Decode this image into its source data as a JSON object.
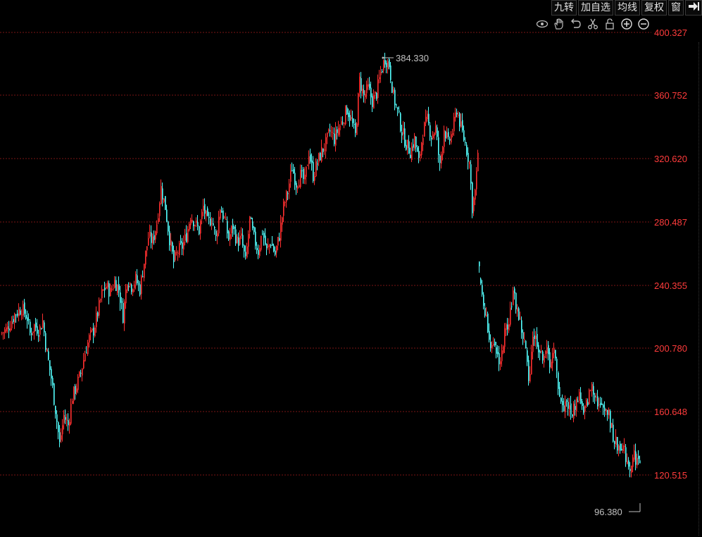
{
  "toolbar": {
    "buttons": [
      "九转",
      "加自选",
      "均线",
      "复权",
      "窗"
    ],
    "exit_icon": "exit-arrow-icon"
  },
  "tools": [
    {
      "name": "eye-icon"
    },
    {
      "name": "hand-icon"
    },
    {
      "name": "undo-icon"
    },
    {
      "name": "scissors-icon"
    },
    {
      "name": "lock-icon"
    },
    {
      "name": "zoom-in-icon"
    },
    {
      "name": "zoom-out-icon"
    }
  ],
  "colors": {
    "background": "#000000",
    "up": "#ff3030",
    "down": "#54ffff",
    "grid": "#7a1515",
    "axis_label": "#ff3b3b",
    "annotation": "#c0c0c0"
  },
  "chart_data": {
    "type": "candlestick",
    "y_ticks": [
      "400.327",
      "360.752",
      "320.620",
      "280.487",
      "240.355",
      "200.780",
      "160.648",
      "120.515"
    ],
    "y_tick_values": [
      400.327,
      360.752,
      320.62,
      280.487,
      240.355,
      200.78,
      160.648,
      120.515
    ],
    "grid": true,
    "annotations": {
      "high": {
        "label": "384.330",
        "value": 384.33
      },
      "low": {
        "label": "96.380",
        "value": 96.38
      }
    },
    "close_path": [
      [
        0,
        210
      ],
      [
        10,
        213
      ],
      [
        20,
        222
      ],
      [
        30,
        226
      ],
      [
        38,
        220
      ],
      [
        42,
        210
      ],
      [
        48,
        215
      ],
      [
        55,
        212
      ],
      [
        60,
        218
      ],
      [
        65,
        200
      ],
      [
        72,
        182
      ],
      [
        78,
        162
      ],
      [
        84,
        140
      ],
      [
        90,
        158
      ],
      [
        96,
        152
      ],
      [
        102,
        170
      ],
      [
        108,
        177
      ],
      [
        114,
        185
      ],
      [
        120,
        198
      ],
      [
        126,
        207
      ],
      [
        132,
        212
      ],
      [
        138,
        223
      ],
      [
        144,
        235
      ],
      [
        150,
        240
      ],
      [
        156,
        236
      ],
      [
        162,
        243
      ],
      [
        168,
        238
      ],
      [
        174,
        221
      ],
      [
        180,
        245
      ],
      [
        186,
        240
      ],
      [
        192,
        244
      ],
      [
        198,
        238
      ],
      [
        204,
        255
      ],
      [
        210,
        271
      ],
      [
        216,
        268
      ],
      [
        222,
        280
      ],
      [
        228,
        302
      ],
      [
        234,
        290
      ],
      [
        240,
        270
      ],
      [
        246,
        255
      ],
      [
        252,
        262
      ],
      [
        258,
        265
      ],
      [
        264,
        272
      ],
      [
        270,
        285
      ],
      [
        276,
        280
      ],
      [
        282,
        275
      ],
      [
        288,
        290
      ],
      [
        294,
        280
      ],
      [
        300,
        283
      ],
      [
        306,
        270
      ],
      [
        312,
        290
      ],
      [
        318,
        282
      ],
      [
        324,
        270
      ],
      [
        330,
        278
      ],
      [
        336,
        268
      ],
      [
        342,
        270
      ],
      [
        348,
        255
      ],
      [
        354,
        282
      ],
      [
        360,
        270
      ],
      [
        366,
        262
      ],
      [
        372,
        275
      ],
      [
        378,
        262
      ],
      [
        384,
        268
      ],
      [
        390,
        260
      ],
      [
        396,
        272
      ],
      [
        402,
        290
      ],
      [
        408,
        300
      ],
      [
        414,
        315
      ],
      [
        420,
        305
      ],
      [
        426,
        310
      ],
      [
        432,
        306
      ],
      [
        438,
        325
      ],
      [
        444,
        310
      ],
      [
        450,
        318
      ],
      [
        456,
        325
      ],
      [
        462,
        330
      ],
      [
        468,
        338
      ],
      [
        474,
        333
      ],
      [
        480,
        340
      ],
      [
        486,
        345
      ],
      [
        492,
        352
      ],
      [
        498,
        345
      ],
      [
        504,
        335
      ],
      [
        510,
        370
      ],
      [
        516,
        360
      ],
      [
        522,
        365
      ],
      [
        528,
        357
      ],
      [
        534,
        362
      ],
      [
        540,
        375
      ],
      [
        546,
        384
      ],
      [
        552,
        380
      ],
      [
        558,
        360
      ],
      [
        564,
        350
      ],
      [
        570,
        338
      ],
      [
        576,
        330
      ],
      [
        582,
        325
      ],
      [
        588,
        333
      ],
      [
        594,
        318
      ],
      [
        600,
        338
      ],
      [
        606,
        345
      ],
      [
        612,
        335
      ],
      [
        618,
        340
      ],
      [
        624,
        315
      ],
      [
        630,
        340
      ],
      [
        636,
        330
      ],
      [
        642,
        338
      ],
      [
        648,
        352
      ],
      [
        654,
        340
      ],
      [
        660,
        330
      ],
      [
        666,
        318
      ],
      [
        670,
        290
      ],
      [
        675,
        302
      ],
      [
        678,
        325
      ],
      [
        680,
        248
      ],
      [
        686,
        228
      ],
      [
        692,
        215
      ],
      [
        698,
        200
      ],
      [
        704,
        198
      ],
      [
        710,
        192
      ],
      [
        716,
        210
      ],
      [
        722,
        220
      ],
      [
        728,
        235
      ],
      [
        734,
        225
      ],
      [
        740,
        212
      ],
      [
        746,
        200
      ],
      [
        750,
        178
      ],
      [
        756,
        210
      ],
      [
        762,
        205
      ],
      [
        768,
        195
      ],
      [
        774,
        200
      ],
      [
        780,
        192
      ],
      [
        786,
        198
      ],
      [
        792,
        178
      ],
      [
        798,
        162
      ],
      [
        804,
        168
      ],
      [
        810,
        158
      ],
      [
        816,
        165
      ],
      [
        822,
        172
      ],
      [
        828,
        158
      ],
      [
        834,
        168
      ],
      [
        840,
        178
      ],
      [
        846,
        170
      ],
      [
        852,
        162
      ],
      [
        858,
        165
      ],
      [
        864,
        158
      ],
      [
        870,
        145
      ],
      [
        876,
        138
      ],
      [
        882,
        140
      ],
      [
        888,
        132
      ],
      [
        894,
        126
      ],
      [
        900,
        133
      ],
      [
        906,
        128
      ],
      [
        908,
        130
      ]
    ]
  }
}
